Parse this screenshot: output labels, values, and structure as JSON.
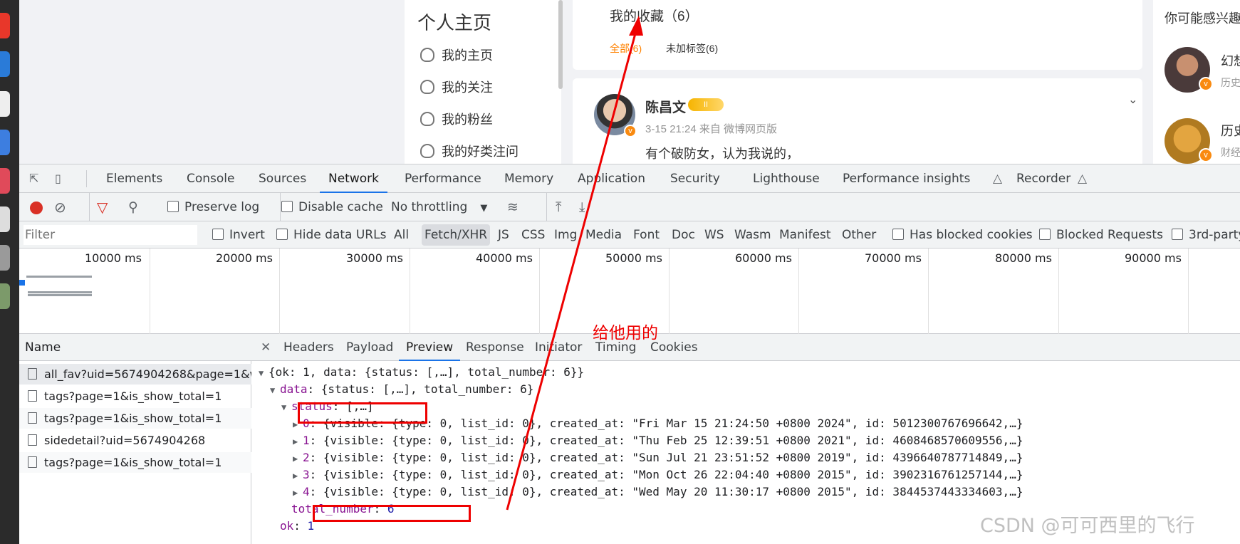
{
  "web": {
    "profile_title": "个人主页",
    "nav": [
      "我的主页",
      "我的关注",
      "我的粉丝",
      "我的好类注问"
    ],
    "favorites_title": "我的收藏（6）",
    "filter_all": "全部(6)",
    "filter_untagged": "未加标签(6)",
    "post": {
      "author": "陈昌文",
      "vip_badge": "II",
      "meta": "3-15 21:24  来自 微博网页版",
      "text": "有个破防女，认为我说的，"
    },
    "suggest": {
      "title": "你可能感兴趣",
      "users": [
        {
          "name": "幻想",
          "sub": "历史"
        },
        {
          "name": "历史",
          "sub": "财经"
        }
      ]
    }
  },
  "devtools": {
    "tabs": [
      "Elements",
      "Console",
      "Sources",
      "Network",
      "Performance",
      "Memory",
      "Application",
      "Security",
      "Lighthouse",
      "Performance insights",
      "Recorder"
    ],
    "active_tab": "Network",
    "toolbar": {
      "preserve_log": "Preserve log",
      "disable_cache": "Disable cache",
      "throttling": "No throttling"
    },
    "filter": {
      "placeholder": "Filter",
      "invert": "Invert",
      "hide_data_urls": "Hide data URLs",
      "types": [
        "All",
        "Fetch/XHR",
        "JS",
        "CSS",
        "Img",
        "Media",
        "Font",
        "Doc",
        "WS",
        "Wasm",
        "Manifest",
        "Other"
      ],
      "active_type": "Fetch/XHR",
      "blocked_cookies": "Has blocked cookies",
      "blocked_requests": "Blocked Requests",
      "third_party": "3rd-party"
    },
    "timeline_labels": [
      "10000 ms",
      "20000 ms",
      "30000 ms",
      "40000 ms",
      "50000 ms",
      "60000 ms",
      "70000 ms",
      "80000 ms",
      "90000 ms"
    ],
    "name_header": "Name",
    "requests": [
      "all_fav?uid=5674904268&page=1&w...",
      "tags?page=1&is_show_total=1",
      "tags?page=1&is_show_total=1",
      "sidedetail?uid=5674904268",
      "tags?page=1&is_show_total=1"
    ],
    "detail_tabs": [
      "Headers",
      "Payload",
      "Preview",
      "Response",
      "Initiator",
      "Timing",
      "Cookies"
    ],
    "active_detail_tab": "Preview",
    "preview": {
      "root": "{ok: 1, data: {status: [,…], total_number: 6}}",
      "data_key": "data",
      "data_val": ": {status: [,…], total_number: 6}",
      "status_key": "status",
      "status_val": ": [,…]",
      "items": [
        {
          "idx": "0",
          "text": ": {visible: {type: 0, list_id: 0}, created_at: \"Fri Mar 15 21:24:50 +0800 2024\", id: 5012300767696642,…}"
        },
        {
          "idx": "1",
          "text": ": {visible: {type: 0, list_id: 0}, created_at: \"Thu Feb 25 12:39:51 +0800 2021\", id: 4608468570609556,…}"
        },
        {
          "idx": "2",
          "text": ": {visible: {type: 0, list_id: 0}, created_at: \"Sun Jul 21 23:51:52 +0800 2019\", id: 4396640787714849,…}"
        },
        {
          "idx": "3",
          "text": ": {visible: {type: 0, list_id: 0}, created_at: \"Mon Oct 26 22:04:40 +0800 2015\", id: 3902316761257144,…}"
        },
        {
          "idx": "4",
          "text": ": {visible: {type: 0, list_id: 0}, created_at: \"Wed May 20 11:30:17 +0800 2015\", id: 3844537443334603,…}"
        }
      ],
      "total_key": "total_number",
      "total_val": "6",
      "ok_key": "ok",
      "ok_val": "1"
    }
  },
  "annotation": {
    "note": "给他用的",
    "color": "#ee0000"
  },
  "watermark": "CSDN @可可西里的飞行"
}
